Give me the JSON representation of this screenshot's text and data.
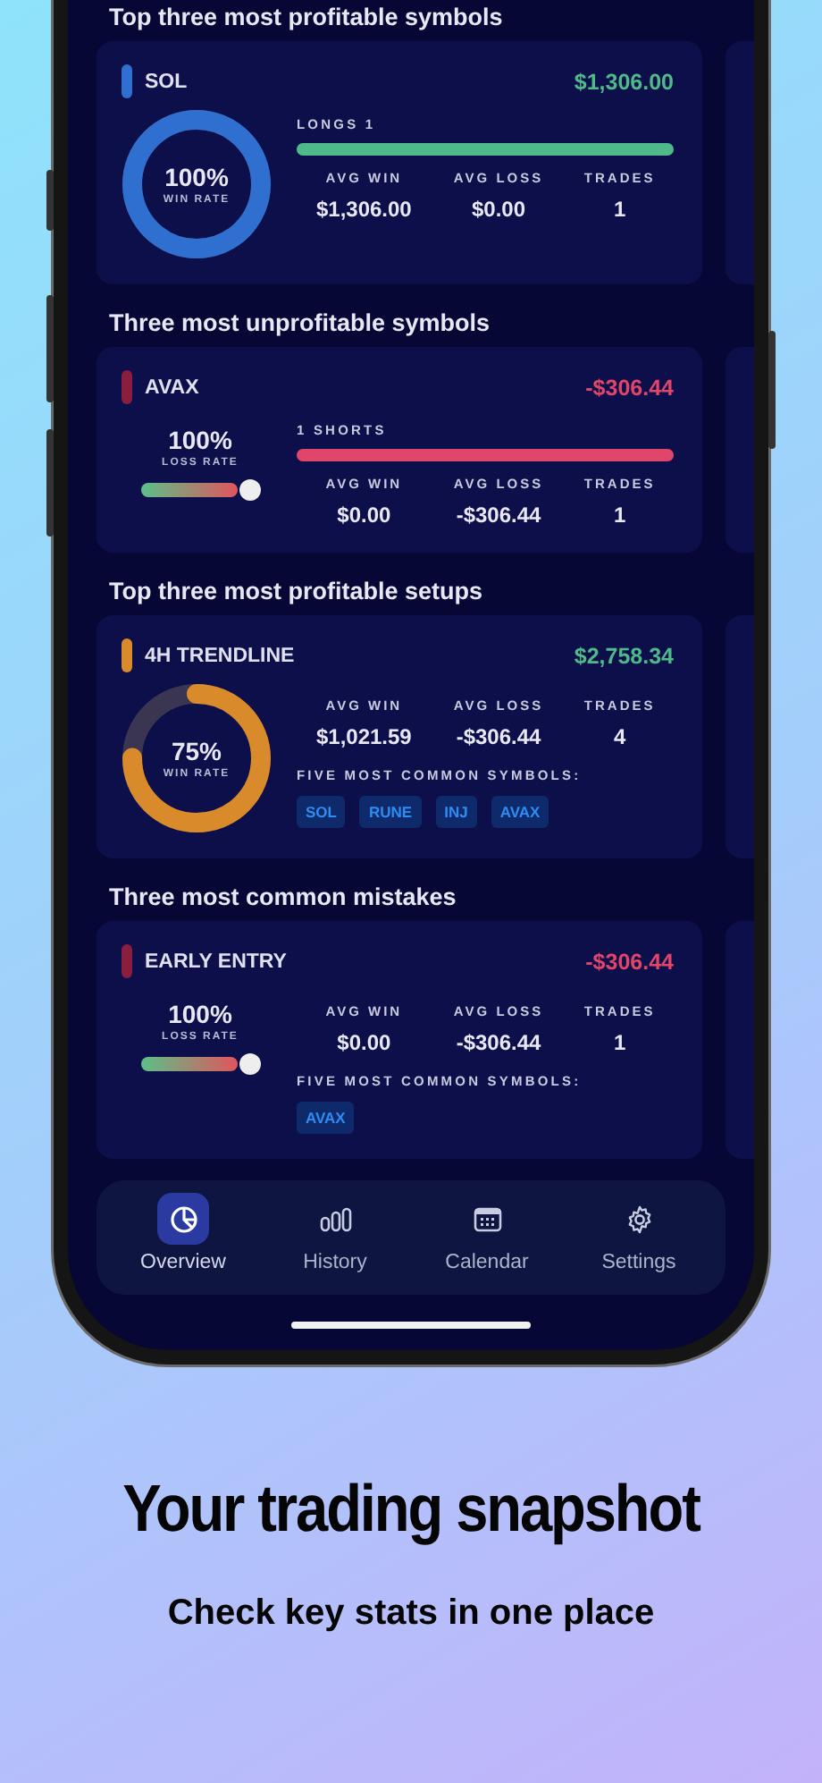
{
  "sections": [
    {
      "title": "Top three most profitable symbols",
      "cards": [
        {
          "name": "SOL",
          "color": "#2f6fd0",
          "total": {
            "text": "$1,306.00",
            "color": "#4fb98a"
          },
          "gauge": {
            "kind": "donut",
            "level": 1,
            "value": "100%",
            "caption": "WIN RATE"
          },
          "direction": {
            "color": "#4fb98a",
            "label": "LONGS 1",
            "level": 1
          },
          "stats": [
            {
              "label": "AVG WIN",
              "value": "$1,306.00"
            },
            {
              "label": "AVG LOSS",
              "value": "$0.00"
            },
            {
              "label": "TRADES",
              "value": "1"
            }
          ]
        }
      ]
    },
    {
      "title": "Three most unprofitable symbols",
      "cards": [
        {
          "name": "AVAX",
          "color": "#8a1e3e",
          "total": {
            "text": "-$306.44",
            "color": "#e0456a"
          },
          "gauge": {
            "kind": "slider",
            "level": 1,
            "value": "100%",
            "caption": "LOSS RATE"
          },
          "direction": {
            "color": "#e0456a",
            "label": "1 SHORTS",
            "level": 1
          },
          "stats": [
            {
              "label": "AVG WIN",
              "value": "$0.00"
            },
            {
              "label": "AVG LOSS",
              "value": "-$306.44"
            },
            {
              "label": "TRADES",
              "value": "1"
            }
          ]
        }
      ]
    },
    {
      "title": "Top three most profitable setups",
      "cards": [
        {
          "name": "4H TRENDLINE",
          "color": "#d98a2a",
          "total": {
            "text": "$2,758.34",
            "color": "#4fb98a"
          },
          "gauge": {
            "kind": "donut",
            "level": 0.75,
            "value": "75%",
            "caption": "WIN RATE"
          },
          "stats": [
            {
              "label": "AVG WIN",
              "value": "$1,021.59"
            },
            {
              "label": "AVG LOSS",
              "value": "-$306.44"
            },
            {
              "label": "TRADES",
              "value": "4"
            }
          ],
          "symbols_label": "FIVE MOST COMMON SYMBOLS:",
          "symbols": [
            "SOL",
            "RUNE",
            "INJ",
            "AVAX"
          ]
        }
      ]
    },
    {
      "title": "Three most common mistakes",
      "cards": [
        {
          "name": "EARLY ENTRY",
          "color": "#8a1e3e",
          "total": {
            "text": "-$306.44",
            "color": "#e0456a"
          },
          "gauge": {
            "kind": "slider",
            "level": 1,
            "value": "100%",
            "caption": "LOSS RATE"
          },
          "stats": [
            {
              "label": "AVG WIN",
              "value": "$0.00"
            },
            {
              "label": "AVG LOSS",
              "value": "-$306.44"
            },
            {
              "label": "TRADES",
              "value": "1"
            }
          ],
          "symbols_label": "FIVE MOST COMMON SYMBOLS:",
          "symbols": [
            "AVAX"
          ]
        }
      ]
    }
  ],
  "tabs": [
    {
      "label": "Overview",
      "selected": true
    },
    {
      "label": "History",
      "selected": false
    },
    {
      "label": "Calendar",
      "selected": false
    },
    {
      "label": "Settings",
      "selected": false
    }
  ],
  "headline": "Your trading snapshot",
  "subheadline": "Check key stats in one place"
}
